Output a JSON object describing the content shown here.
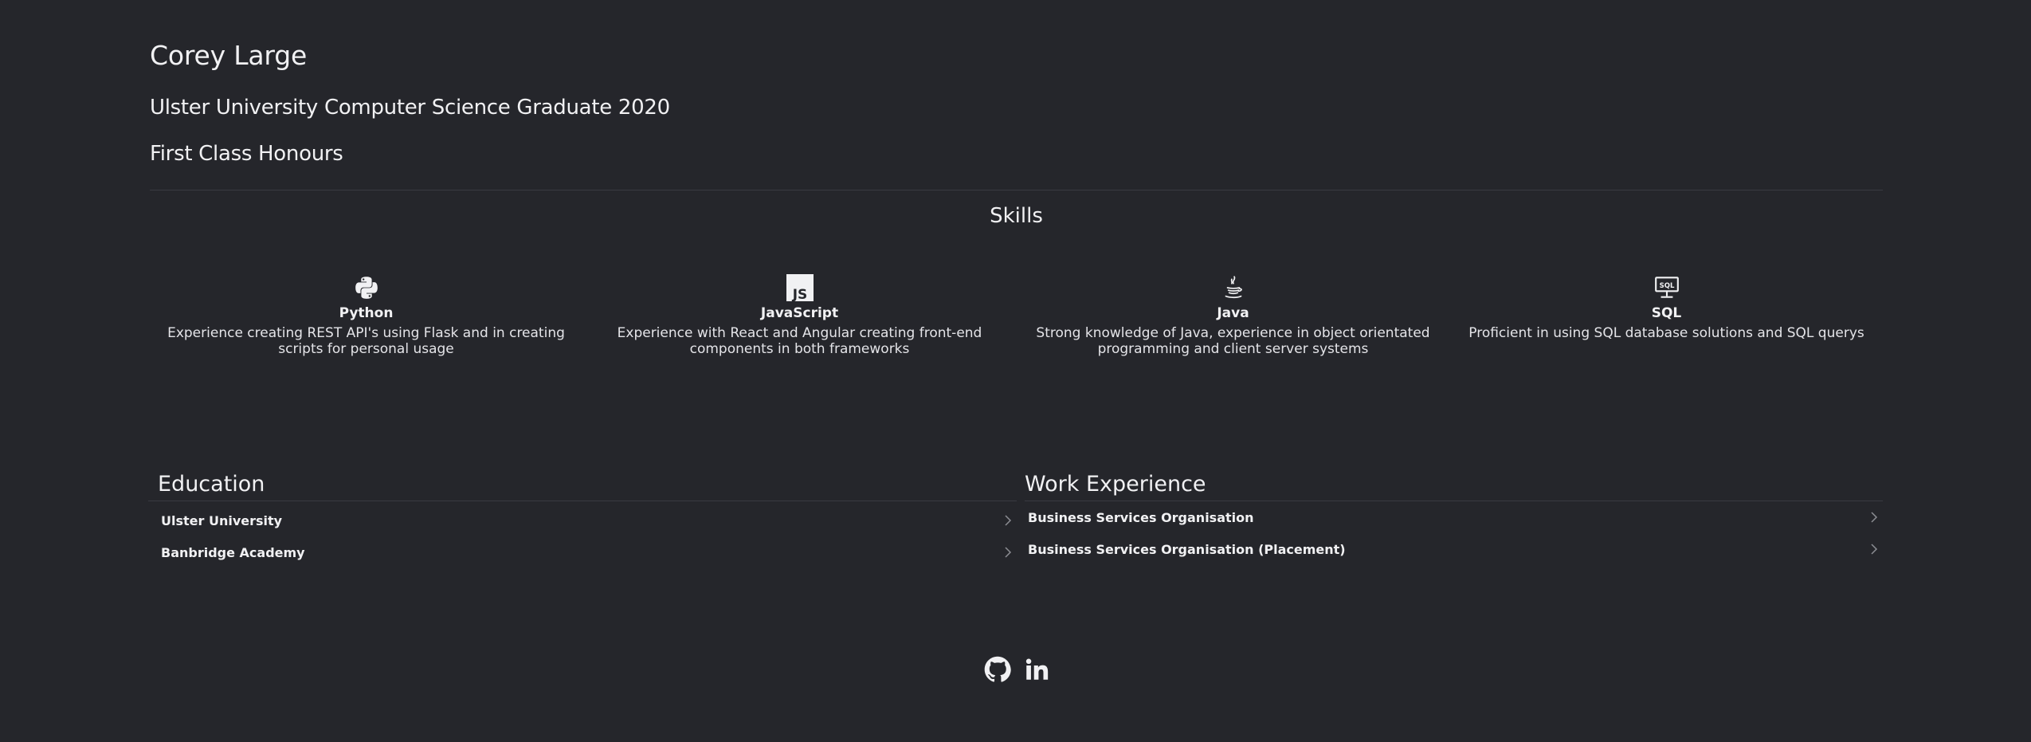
{
  "header": {
    "name": "Corey Large",
    "degree": "Ulster University Computer Science Graduate 2020",
    "classification": "First Class Honours"
  },
  "skills": {
    "title": "Skills",
    "items": [
      {
        "name": "Python",
        "icon": "python-icon",
        "description": "Experience creating REST API's using Flask and in creating scripts for personal usage"
      },
      {
        "name": "JavaScript",
        "icon": "javascript-icon",
        "description": "Experience with React and Angular creating front-end components in both frameworks"
      },
      {
        "name": "Java",
        "icon": "java-icon",
        "description": "Strong knowledge of Java, experience in object orientated programming and client server systems"
      },
      {
        "name": "SQL",
        "icon": "sql-icon",
        "description": "Proficient in using SQL database solutions and SQL querys"
      }
    ]
  },
  "education": {
    "title": "Education",
    "items": [
      {
        "label": "Ulster University"
      },
      {
        "label": "Banbridge Academy"
      }
    ]
  },
  "work": {
    "title": "Work Experience",
    "items": [
      {
        "label": "Business Services Organisation"
      },
      {
        "label": "Business Services Organisation (Placement)"
      }
    ]
  },
  "socials": [
    {
      "icon": "github-icon"
    },
    {
      "icon": "linkedin-icon"
    }
  ],
  "colors": {
    "background": "#25262b",
    "text": "#f1f1f3",
    "divider": "#3a3b41"
  }
}
